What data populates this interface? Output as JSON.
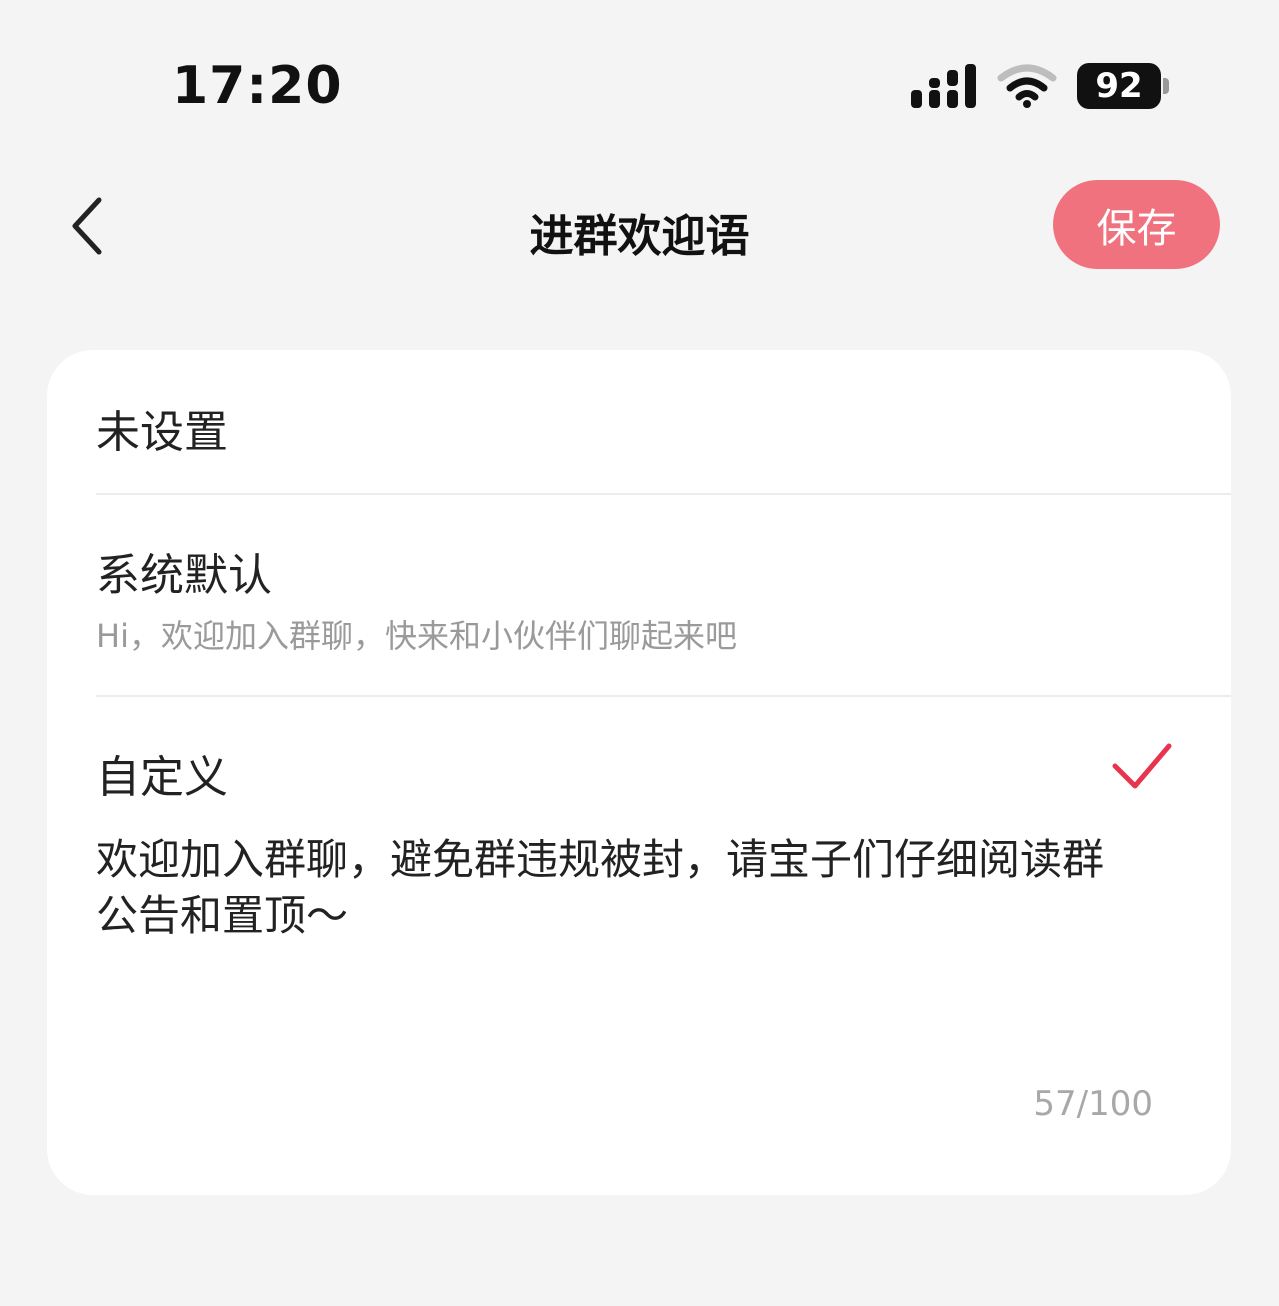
{
  "status_bar": {
    "time": "17:20",
    "battery": "92",
    "icons": [
      "signal-icon",
      "wifi-icon",
      "battery-icon"
    ]
  },
  "nav": {
    "title": "进群欢迎语",
    "save_label": "保存",
    "back_icon": "chevron-left-icon"
  },
  "options": [
    {
      "label": "未设置",
      "description": ""
    },
    {
      "label": "系统默认",
      "description": "Hi，欢迎加入群聊，快来和小伙伴们聊起来吧"
    },
    {
      "label": "自定义",
      "description": "",
      "selected": true
    }
  ],
  "custom": {
    "text": "欢迎加入群聊，避免群违规被封，请宝子们仔细阅读群公告和置顶～",
    "count": "57/100"
  },
  "colors": {
    "accent": "#f0727f",
    "check": "#e8344e",
    "background": "#f4f4f4"
  }
}
